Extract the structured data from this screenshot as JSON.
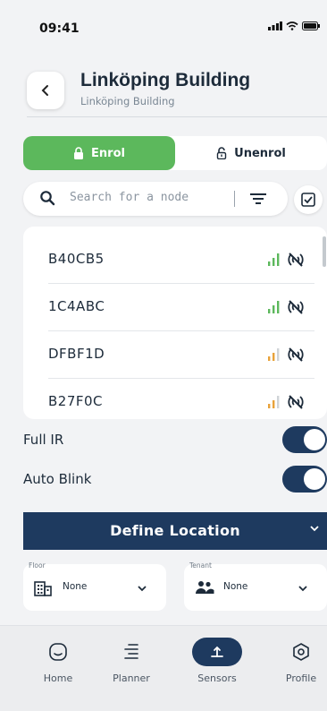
{
  "status_bar": {
    "time": "09:41"
  },
  "header": {
    "title": "Linköping Building",
    "subtitle": "Linköping Building"
  },
  "segment": {
    "enrol_label": "Enrol",
    "unenrol_label": "Unenrol",
    "active": "enrol"
  },
  "search": {
    "placeholder": "Search for a node",
    "value": ""
  },
  "nodes": [
    {
      "id": "B40CB5",
      "signal_color": "#5cb85c"
    },
    {
      "id": "1C4ABC",
      "signal_color": "#5cb85c"
    },
    {
      "id": "DFBF1D",
      "signal_color": "#e8a23a"
    },
    {
      "id": "B27F0C",
      "signal_color": "#e8a23a"
    }
  ],
  "toggles": {
    "full_ir": {
      "label": "Full IR",
      "on": true
    },
    "auto_blink": {
      "label": "Auto Blink",
      "on": true
    }
  },
  "define_location": {
    "label": "Define Location"
  },
  "floor": {
    "label": "Floor",
    "value": "None"
  },
  "tenant": {
    "label": "Tenant",
    "value": "None"
  },
  "nav": {
    "items": [
      {
        "label": "Home",
        "icon": "home-icon"
      },
      {
        "label": "Planner",
        "icon": "planner-icon"
      },
      {
        "label": "Sensors",
        "icon": "sensors-icon",
        "active": true
      },
      {
        "label": "Profile",
        "icon": "profile-icon"
      }
    ]
  },
  "colors": {
    "primary": "#1e3a5f",
    "accent_green": "#5cb85c",
    "signal_orange": "#e8a23a"
  }
}
